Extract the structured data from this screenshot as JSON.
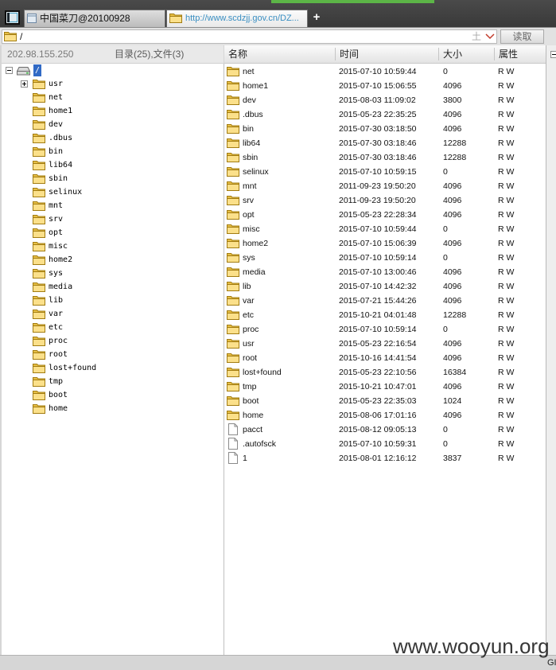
{
  "colors": {
    "selection": "#316ac5",
    "active_tab_text": "#3a8fc2",
    "loading_bar": "#5cb547"
  },
  "app_icon": "sidebar-toggle-icon",
  "tabs": [
    {
      "label": "中国菜刀@20100928",
      "icon": "window-icon",
      "active": false
    },
    {
      "label": "http://www.scdzjj.gov.cn/DZ...",
      "icon": "folder-icon",
      "active": true
    }
  ],
  "new_tab_label": "+",
  "address_bar": {
    "icon": "folder-icon",
    "value": "/",
    "extra_glyph": "土",
    "dropdown_icon": "chevron-down-icon",
    "read_button": "读取"
  },
  "left_panel": {
    "host": "202.98.155.250",
    "summary": "目录(25),文件(3)",
    "tree": {
      "root": {
        "label": "/",
        "icon": "drive-icon",
        "expander": "minus-box-icon",
        "selected": true
      },
      "children": [
        {
          "label": "usr",
          "icon": "folder-icon",
          "expander": "plus-box-icon"
        },
        {
          "label": "net",
          "icon": "folder-icon"
        },
        {
          "label": "home1",
          "icon": "folder-icon"
        },
        {
          "label": "dev",
          "icon": "folder-icon"
        },
        {
          "label": ".dbus",
          "icon": "folder-icon"
        },
        {
          "label": "bin",
          "icon": "folder-icon"
        },
        {
          "label": "lib64",
          "icon": "folder-icon"
        },
        {
          "label": "sbin",
          "icon": "folder-icon"
        },
        {
          "label": "selinux",
          "icon": "folder-icon"
        },
        {
          "label": "mnt",
          "icon": "folder-icon"
        },
        {
          "label": "srv",
          "icon": "folder-icon"
        },
        {
          "label": "opt",
          "icon": "folder-icon"
        },
        {
          "label": "misc",
          "icon": "folder-icon"
        },
        {
          "label": "home2",
          "icon": "folder-icon"
        },
        {
          "label": "sys",
          "icon": "folder-icon"
        },
        {
          "label": "media",
          "icon": "folder-icon"
        },
        {
          "label": "lib",
          "icon": "folder-icon"
        },
        {
          "label": "var",
          "icon": "folder-icon"
        },
        {
          "label": "etc",
          "icon": "folder-icon"
        },
        {
          "label": "proc",
          "icon": "folder-icon"
        },
        {
          "label": "root",
          "icon": "folder-icon"
        },
        {
          "label": "lost+found",
          "icon": "folder-icon"
        },
        {
          "label": "tmp",
          "icon": "folder-icon"
        },
        {
          "label": "boot",
          "icon": "folder-icon"
        },
        {
          "label": "home",
          "icon": "folder-icon"
        }
      ]
    }
  },
  "file_list": {
    "columns": {
      "name": "名称",
      "time": "时间",
      "size": "大小",
      "attr": "属性"
    },
    "rows": [
      {
        "icon": "folder-icon",
        "name": "net",
        "time": "2015-07-10 10:59:44",
        "size": 0,
        "attr": "R W"
      },
      {
        "icon": "folder-icon",
        "name": "home1",
        "time": "2015-07-10 15:06:55",
        "size": 4096,
        "attr": "R W"
      },
      {
        "icon": "folder-icon",
        "name": "dev",
        "time": "2015-08-03 11:09:02",
        "size": 3800,
        "attr": "R W"
      },
      {
        "icon": "folder-icon",
        "name": ".dbus",
        "time": "2015-05-23 22:35:25",
        "size": 4096,
        "attr": "R W"
      },
      {
        "icon": "folder-icon",
        "name": "bin",
        "time": "2015-07-30 03:18:50",
        "size": 4096,
        "attr": "R W"
      },
      {
        "icon": "folder-icon",
        "name": "lib64",
        "time": "2015-07-30 03:18:46",
        "size": 12288,
        "attr": "R W"
      },
      {
        "icon": "folder-icon",
        "name": "sbin",
        "time": "2015-07-30 03:18:46",
        "size": 12288,
        "attr": "R W"
      },
      {
        "icon": "folder-icon",
        "name": "selinux",
        "time": "2015-07-10 10:59:15",
        "size": 0,
        "attr": "R W"
      },
      {
        "icon": "folder-icon",
        "name": "mnt",
        "time": "2011-09-23 19:50:20",
        "size": 4096,
        "attr": "R W"
      },
      {
        "icon": "folder-icon",
        "name": "srv",
        "time": "2011-09-23 19:50:20",
        "size": 4096,
        "attr": "R W"
      },
      {
        "icon": "folder-icon",
        "name": "opt",
        "time": "2015-05-23 22:28:34",
        "size": 4096,
        "attr": "R W"
      },
      {
        "icon": "folder-icon",
        "name": "misc",
        "time": "2015-07-10 10:59:44",
        "size": 0,
        "attr": "R W"
      },
      {
        "icon": "folder-icon",
        "name": "home2",
        "time": "2015-07-10 15:06:39",
        "size": 4096,
        "attr": "R W"
      },
      {
        "icon": "folder-icon",
        "name": "sys",
        "time": "2015-07-10 10:59:14",
        "size": 0,
        "attr": "R W"
      },
      {
        "icon": "folder-icon",
        "name": "media",
        "time": "2015-07-10 13:00:46",
        "size": 4096,
        "attr": "R W"
      },
      {
        "icon": "folder-icon",
        "name": "lib",
        "time": "2015-07-10 14:42:32",
        "size": 4096,
        "attr": "R W"
      },
      {
        "icon": "folder-icon",
        "name": "var",
        "time": "2015-07-21 15:44:26",
        "size": 4096,
        "attr": "R W"
      },
      {
        "icon": "folder-icon",
        "name": "etc",
        "time": "2015-10-21 04:01:48",
        "size": 12288,
        "attr": "R W"
      },
      {
        "icon": "folder-icon",
        "name": "proc",
        "time": "2015-07-10 10:59:14",
        "size": 0,
        "attr": "R W"
      },
      {
        "icon": "folder-icon",
        "name": "usr",
        "time": "2015-05-23 22:16:54",
        "size": 4096,
        "attr": "R W"
      },
      {
        "icon": "folder-icon",
        "name": "root",
        "time": "2015-10-16 14:41:54",
        "size": 4096,
        "attr": "R W"
      },
      {
        "icon": "folder-icon",
        "name": "lost+found",
        "time": "2015-05-23 22:10:56",
        "size": 16384,
        "attr": "R W"
      },
      {
        "icon": "folder-icon",
        "name": "tmp",
        "time": "2015-10-21 10:47:01",
        "size": 4096,
        "attr": "R W"
      },
      {
        "icon": "folder-icon",
        "name": "boot",
        "time": "2015-05-23 22:35:03",
        "size": 1024,
        "attr": "R W"
      },
      {
        "icon": "folder-icon",
        "name": "home",
        "time": "2015-08-06 17:01:16",
        "size": 4096,
        "attr": "R W"
      },
      {
        "icon": "file-icon",
        "name": "pacct",
        "time": "2015-08-12 09:05:13",
        "size": 0,
        "attr": "R W"
      },
      {
        "icon": "file-icon",
        "name": ".autofsck",
        "time": "2015-07-10 10:59:31",
        "size": 0,
        "attr": "R W"
      },
      {
        "icon": "file-icon",
        "name": "1",
        "time": "2015-08-01 12:16:12",
        "size": 3837,
        "attr": "R W"
      }
    ]
  },
  "side_strip": {
    "icon": "minus-box-icon"
  },
  "status_bar": {
    "corner_text": "GI"
  },
  "watermark": "www.wooyun.org"
}
